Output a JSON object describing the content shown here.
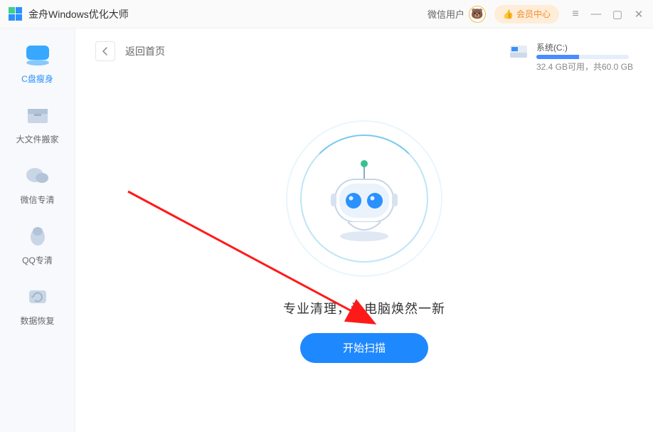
{
  "titlebar": {
    "app_title": "金舟Windows优化大师",
    "user_label": "微信用户",
    "member_label": "会员中心"
  },
  "sidebar": {
    "items": [
      {
        "id": "c-disk",
        "label": "C盘瘦身"
      },
      {
        "id": "bigfile",
        "label": "大文件搬家"
      },
      {
        "id": "wechat",
        "label": "微信专清"
      },
      {
        "id": "qq",
        "label": "QQ专清"
      },
      {
        "id": "recover",
        "label": "数据恢复"
      }
    ]
  },
  "main": {
    "back_label": "返回首页",
    "disk": {
      "name": "系统(C:)",
      "usage_text": "32.4 GB可用，共60.0 GB",
      "used_fraction": 0.46
    },
    "slogan": "专业清理，让电脑焕然一新",
    "scan_button": "开始扫描"
  }
}
